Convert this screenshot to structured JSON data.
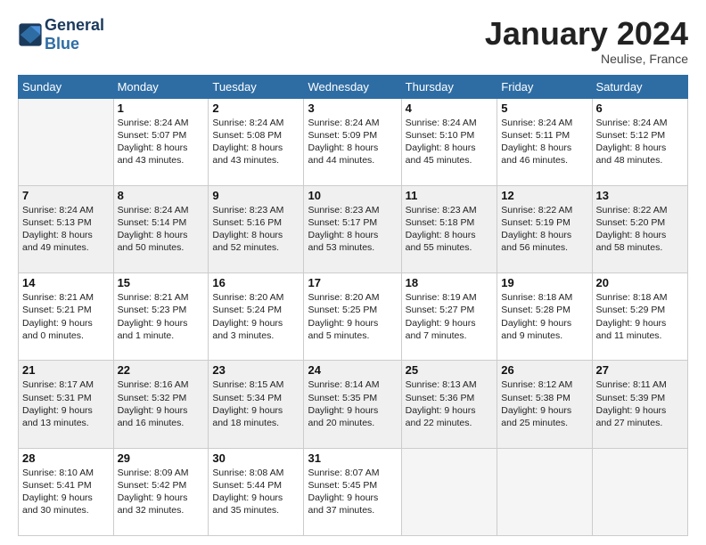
{
  "header": {
    "logo_line1": "General",
    "logo_line2": "Blue",
    "month": "January 2024",
    "location": "Neulise, France"
  },
  "days_of_week": [
    "Sunday",
    "Monday",
    "Tuesday",
    "Wednesday",
    "Thursday",
    "Friday",
    "Saturday"
  ],
  "weeks": [
    [
      {
        "day": "",
        "info": ""
      },
      {
        "day": "1",
        "info": "Sunrise: 8:24 AM\nSunset: 5:07 PM\nDaylight: 8 hours\nand 43 minutes."
      },
      {
        "day": "2",
        "info": "Sunrise: 8:24 AM\nSunset: 5:08 PM\nDaylight: 8 hours\nand 43 minutes."
      },
      {
        "day": "3",
        "info": "Sunrise: 8:24 AM\nSunset: 5:09 PM\nDaylight: 8 hours\nand 44 minutes."
      },
      {
        "day": "4",
        "info": "Sunrise: 8:24 AM\nSunset: 5:10 PM\nDaylight: 8 hours\nand 45 minutes."
      },
      {
        "day": "5",
        "info": "Sunrise: 8:24 AM\nSunset: 5:11 PM\nDaylight: 8 hours\nand 46 minutes."
      },
      {
        "day": "6",
        "info": "Sunrise: 8:24 AM\nSunset: 5:12 PM\nDaylight: 8 hours\nand 48 minutes."
      }
    ],
    [
      {
        "day": "7",
        "info": "Sunrise: 8:24 AM\nSunset: 5:13 PM\nDaylight: 8 hours\nand 49 minutes."
      },
      {
        "day": "8",
        "info": "Sunrise: 8:24 AM\nSunset: 5:14 PM\nDaylight: 8 hours\nand 50 minutes."
      },
      {
        "day": "9",
        "info": "Sunrise: 8:23 AM\nSunset: 5:16 PM\nDaylight: 8 hours\nand 52 minutes."
      },
      {
        "day": "10",
        "info": "Sunrise: 8:23 AM\nSunset: 5:17 PM\nDaylight: 8 hours\nand 53 minutes."
      },
      {
        "day": "11",
        "info": "Sunrise: 8:23 AM\nSunset: 5:18 PM\nDaylight: 8 hours\nand 55 minutes."
      },
      {
        "day": "12",
        "info": "Sunrise: 8:22 AM\nSunset: 5:19 PM\nDaylight: 8 hours\nand 56 minutes."
      },
      {
        "day": "13",
        "info": "Sunrise: 8:22 AM\nSunset: 5:20 PM\nDaylight: 8 hours\nand 58 minutes."
      }
    ],
    [
      {
        "day": "14",
        "info": "Sunrise: 8:21 AM\nSunset: 5:21 PM\nDaylight: 9 hours\nand 0 minutes."
      },
      {
        "day": "15",
        "info": "Sunrise: 8:21 AM\nSunset: 5:23 PM\nDaylight: 9 hours\nand 1 minute."
      },
      {
        "day": "16",
        "info": "Sunrise: 8:20 AM\nSunset: 5:24 PM\nDaylight: 9 hours\nand 3 minutes."
      },
      {
        "day": "17",
        "info": "Sunrise: 8:20 AM\nSunset: 5:25 PM\nDaylight: 9 hours\nand 5 minutes."
      },
      {
        "day": "18",
        "info": "Sunrise: 8:19 AM\nSunset: 5:27 PM\nDaylight: 9 hours\nand 7 minutes."
      },
      {
        "day": "19",
        "info": "Sunrise: 8:18 AM\nSunset: 5:28 PM\nDaylight: 9 hours\nand 9 minutes."
      },
      {
        "day": "20",
        "info": "Sunrise: 8:18 AM\nSunset: 5:29 PM\nDaylight: 9 hours\nand 11 minutes."
      }
    ],
    [
      {
        "day": "21",
        "info": "Sunrise: 8:17 AM\nSunset: 5:31 PM\nDaylight: 9 hours\nand 13 minutes."
      },
      {
        "day": "22",
        "info": "Sunrise: 8:16 AM\nSunset: 5:32 PM\nDaylight: 9 hours\nand 16 minutes."
      },
      {
        "day": "23",
        "info": "Sunrise: 8:15 AM\nSunset: 5:34 PM\nDaylight: 9 hours\nand 18 minutes."
      },
      {
        "day": "24",
        "info": "Sunrise: 8:14 AM\nSunset: 5:35 PM\nDaylight: 9 hours\nand 20 minutes."
      },
      {
        "day": "25",
        "info": "Sunrise: 8:13 AM\nSunset: 5:36 PM\nDaylight: 9 hours\nand 22 minutes."
      },
      {
        "day": "26",
        "info": "Sunrise: 8:12 AM\nSunset: 5:38 PM\nDaylight: 9 hours\nand 25 minutes."
      },
      {
        "day": "27",
        "info": "Sunrise: 8:11 AM\nSunset: 5:39 PM\nDaylight: 9 hours\nand 27 minutes."
      }
    ],
    [
      {
        "day": "28",
        "info": "Sunrise: 8:10 AM\nSunset: 5:41 PM\nDaylight: 9 hours\nand 30 minutes."
      },
      {
        "day": "29",
        "info": "Sunrise: 8:09 AM\nSunset: 5:42 PM\nDaylight: 9 hours\nand 32 minutes."
      },
      {
        "day": "30",
        "info": "Sunrise: 8:08 AM\nSunset: 5:44 PM\nDaylight: 9 hours\nand 35 minutes."
      },
      {
        "day": "31",
        "info": "Sunrise: 8:07 AM\nSunset: 5:45 PM\nDaylight: 9 hours\nand 37 minutes."
      },
      {
        "day": "",
        "info": ""
      },
      {
        "day": "",
        "info": ""
      },
      {
        "day": "",
        "info": ""
      }
    ]
  ]
}
